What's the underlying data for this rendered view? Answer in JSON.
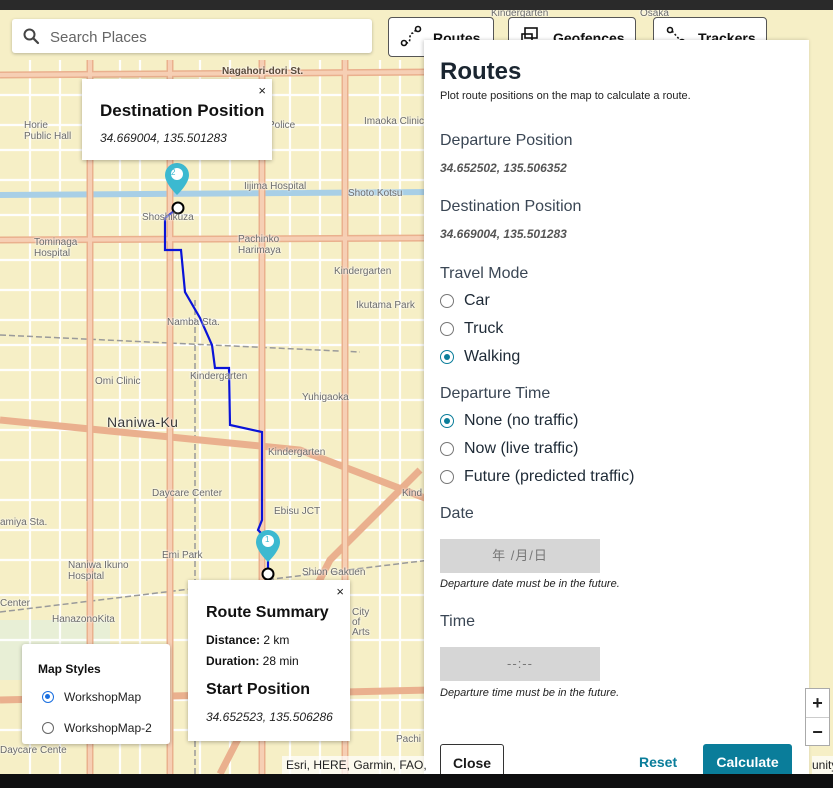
{
  "search": {
    "placeholder": "Search Places"
  },
  "tabs": [
    {
      "label": "Routes",
      "icon": "route-icon"
    },
    {
      "label": "Geofences",
      "icon": "geofence-icon"
    },
    {
      "label": "Trackers",
      "icon": "tracker-icon"
    }
  ],
  "panel": {
    "title": "Routes",
    "subtitle": "Plot route positions on the map to calculate a route.",
    "departure_label": "Departure Position",
    "departure_value": "34.652502, 135.506352",
    "destination_label": "Destination Position",
    "destination_value": "34.669004, 135.501283",
    "travel_mode_label": "Travel Mode",
    "travel_modes": [
      {
        "label": "Car",
        "selected": false
      },
      {
        "label": "Truck",
        "selected": false
      },
      {
        "label": "Walking",
        "selected": true
      }
    ],
    "departure_time_label": "Departure Time",
    "departure_times": [
      {
        "label": "None (no traffic)",
        "selected": true
      },
      {
        "label": "Now (live traffic)",
        "selected": false
      },
      {
        "label": "Future (predicted traffic)",
        "selected": false
      }
    ],
    "date_label": "Date",
    "date_value": "年 /月/日",
    "date_note": "Departure date must be in the future.",
    "time_label": "Time",
    "time_value": "--:--",
    "time_note": "Departure time must be in the future.",
    "close_label": "Close",
    "reset_label": "Reset",
    "calculate_label": "Calculate",
    "accent_color": "#0a7d9a"
  },
  "destination_popup": {
    "title": "Destination Position",
    "coords": "34.669004, 135.501283",
    "close": "×"
  },
  "summary_popup": {
    "title": "Route Summary",
    "distance_label": "Distance:",
    "distance_value": "2 km",
    "duration_label": "Duration:",
    "duration_value": "28 min",
    "start_title": "Start Position",
    "start_coords": "34.652523, 135.506286",
    "close": "×"
  },
  "map_styles": {
    "title": "Map Styles",
    "options": [
      {
        "label": "WorkshopMap",
        "selected": true
      },
      {
        "label": "WorkshopMap-2",
        "selected": false
      }
    ]
  },
  "markers": {
    "destination": "2",
    "start": "1"
  },
  "zoom": {
    "in": "+",
    "out": "−"
  },
  "attribution": "Esri, HERE, Garmin, FAO,",
  "attribution_right": "unity",
  "map_labels": {
    "nagahori": "Nagahori-dori St.",
    "kindergarten_top": "Kindergarten",
    "osaka": "Osaka",
    "horie": "Horie\nPublic Hall",
    "police": "Police",
    "imaoka": "Imaoka Clinic",
    "iijima": "Iijima Hospital",
    "shoto": "Shoto Kotsu",
    "shinsaibashi": "Shoshikuza",
    "tominaga": "Tominaga\nHospital",
    "pachinko": "Pachinko\nHarimaya",
    "kindergarten2": "Kindergarten",
    "ikutama": "Ikutama Park",
    "namba": "Namba Sta.",
    "kindergarten3": "Kindergarten",
    "omi": "Omi Clinic",
    "yuhigaoka": "Yuhigaoka",
    "naniwa": "Naniwa-Ku",
    "kindergarten4": "Kindergarten",
    "daycare": "Daycare Center",
    "ebisu": "Ebisu JCT",
    "emi": "Emi Park",
    "naniwaikuno": "Naniwa Ikuno\nHospital",
    "hanazono": "HanazonoKita",
    "shion": "Shion Gakuen",
    "city": "City\nof\nArts",
    "amiya": "amiya Sta.",
    "center": "Center",
    "daycare2": "Daycare Cente",
    "kind_left": "Kind",
    "pachi": "Pachi"
  }
}
